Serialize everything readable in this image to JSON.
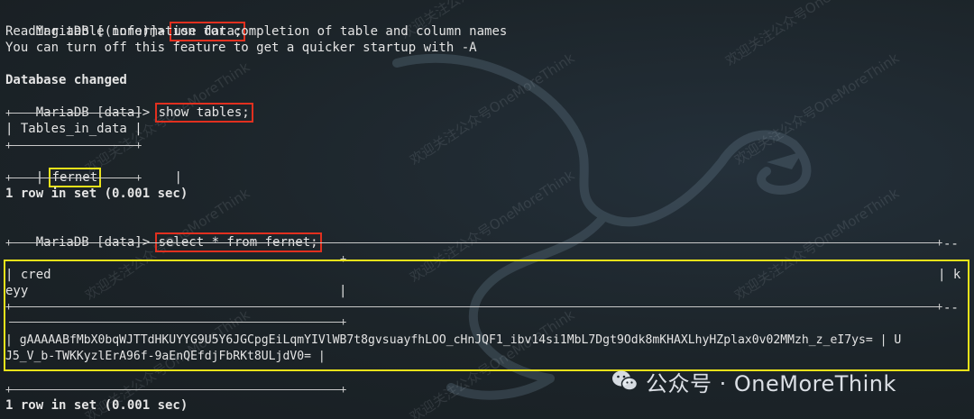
{
  "terminal": {
    "lines": {
      "l1_prompt": "MariaDB [(none)]> ",
      "l1_cmd": "use data;",
      "l2": "Reading table information for completion of table and column names",
      "l3": "You can turn off this feature to get a quicker startup with -A",
      "l4": "Database changed",
      "l5_prompt": "MariaDB [data]> ",
      "l5_cmd": "show tables;",
      "l6_border": "+───────────────+",
      "l7": "| Tables_in_data |",
      "l8_border": "+───────────────+",
      "l9_open": "| ",
      "l9_value": "fernet",
      "l9_close": "          |",
      "l10_border": "+───────────────+",
      "l11": "1 row in set (0.001 sec)",
      "l12_prompt": "MariaDB [data]> ",
      "l12_cmd": "select * from fernet;",
      "r_header_1": "| cred",
      "r_header_1_end": "| k",
      "r_header_2": "eyy",
      "r_header_2_end": "|",
      "r_value_1": "| gAAAAABfMbX0bqWJTTdHKUYYG9U5Y6JGCpgEiLqmYIVlWB7t8gvsuayfhLOO_cHnJQF1_ibv14si1MbL7Dgt9Odk8mKHAXLhyHZplax0v02MMzh_z_eI7ys= | U",
      "r_value_2": "J5_V_b-TWKKyzlErA96f-9aEnQEfdjFbRKt8ULjdV0= |",
      "trailing_dash": "--",
      "l_final": "1 row in set (0.001 sec)"
    }
  },
  "watermark": {
    "text": "欢迎关注公众号OneMoreThink"
  },
  "brand": {
    "label": "公众号 · OneMoreThink",
    "icon": "wechat-icon"
  },
  "colors": {
    "background": "#1c2227",
    "text": "#e4e4e4",
    "highlight_red": "#e1301f",
    "highlight_yellow": "#e9e21a"
  }
}
